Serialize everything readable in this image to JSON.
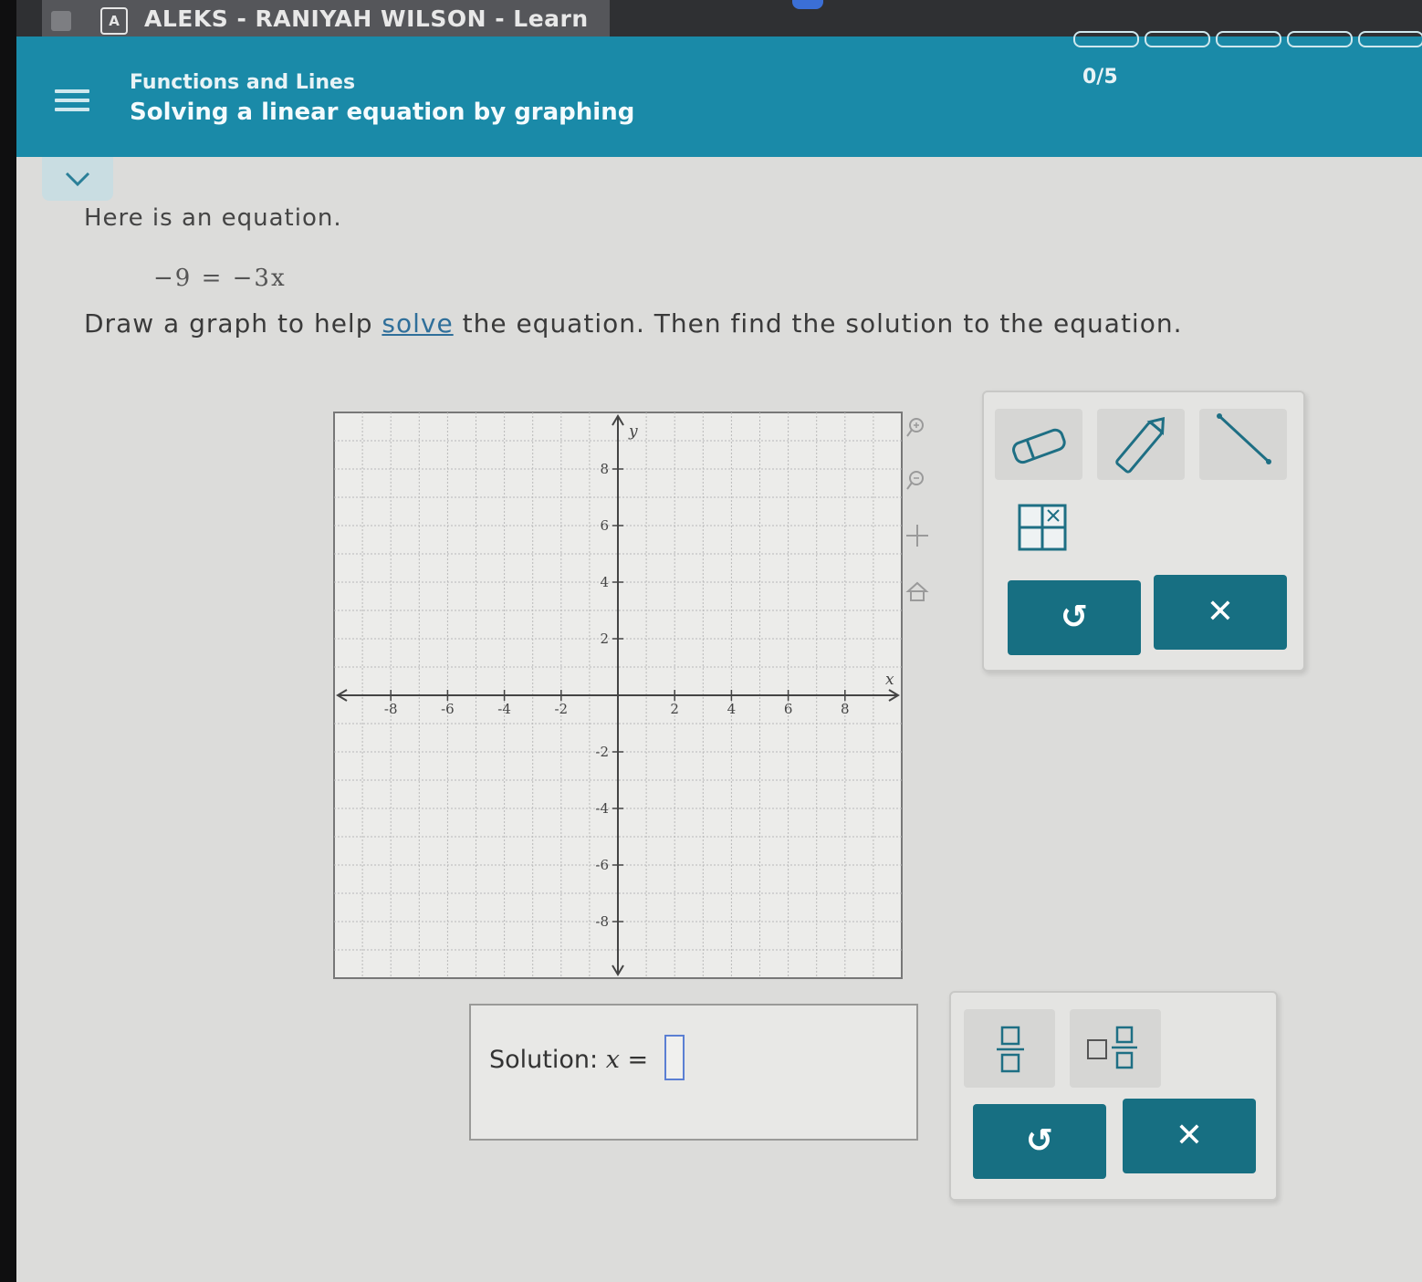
{
  "browser": {
    "tab_logo": "A",
    "tab_title": "ALEKS - RANIYAH WILSON - Learn"
  },
  "header": {
    "topic": "Functions and Lines",
    "lesson": "Solving a linear equation by graphing",
    "progress": "0/5",
    "progress_segments": 5,
    "progress_filled": 0
  },
  "problem": {
    "intro": "Here is an equation.",
    "equation": "−9 = −3x",
    "instruction_before": "Draw a graph to help ",
    "instruction_link": "solve",
    "instruction_after": " the equation. Then find the solution to the equation."
  },
  "graph": {
    "xlim": [
      -10,
      10
    ],
    "ylim": [
      -10,
      10
    ],
    "grid_step": 1,
    "tick_labels": [
      -8,
      -6,
      -4,
      -2,
      2,
      4,
      6,
      8
    ],
    "x_axis_label": "x",
    "y_axis_label": "y",
    "side_controls": [
      "zoom-in-icon",
      "zoom-out-icon",
      "move-icon",
      "home-icon"
    ]
  },
  "graph_tools": {
    "tools": [
      "eraser-icon",
      "pencil-icon",
      "line-tool-icon",
      "table-icon"
    ],
    "undo_symbol": "↺",
    "clear_symbol": "✕"
  },
  "solution": {
    "label": "Solution:",
    "variable": "x",
    "equals": "=",
    "value": ""
  },
  "answer_tools": {
    "tools": [
      "fraction-icon",
      "mixed-number-icon"
    ],
    "undo_symbol": "↺",
    "clear_symbol": "✕"
  },
  "colors": {
    "header_bg": "#1a8aa8",
    "action_button": "#176f82",
    "link": "#2f6f9a",
    "input_border": "#5b7fd3"
  }
}
